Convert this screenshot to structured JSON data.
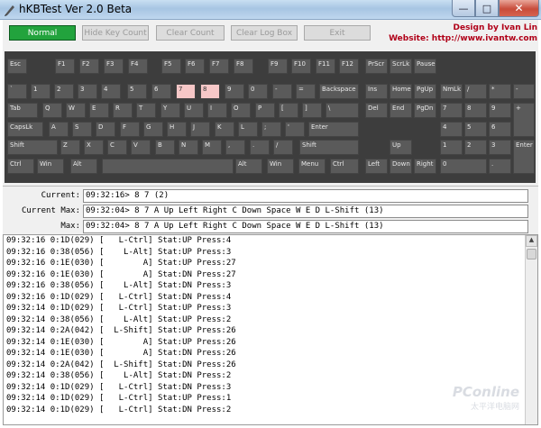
{
  "window": {
    "title": "hKBTest Ver 2.0 Beta",
    "min": "—",
    "max": "□",
    "close": "✕"
  },
  "toolbar": {
    "normal": "Normal",
    "hide_key_count": "Hide Key Count",
    "clear_count": "Clear Count",
    "clear_log_box": "Clear Log Box",
    "exit": "Exit"
  },
  "credits": {
    "line1": "Design by Ivan Lin",
    "line2": "Website: http://www.ivantw.com"
  },
  "keys": {
    "esc": "Esc",
    "f1": "F1",
    "f2": "F2",
    "f3": "F3",
    "f4": "F4",
    "f5": "F5",
    "f6": "F6",
    "f7": "F7",
    "f8": "F8",
    "f9": "F9",
    "f10": "F10",
    "f11": "F11",
    "f12": "F12",
    "prscr": "PrScr",
    "scrlk": "ScrLk",
    "pause": "Pause",
    "grave": "`",
    "k1": "1",
    "k2": "2",
    "k3": "3",
    "k4": "4",
    "k5": "5",
    "k6": "6",
    "k7": "7",
    "k8": "8",
    "k9": "9",
    "k0": "0",
    "minus": "-",
    "equal": "=",
    "backspace": "Backspace",
    "ins": "Ins",
    "home": "Home",
    "pgup": "PgUp",
    "numlk": "NmLk",
    "numslash": "/",
    "numstar": "*",
    "numminus": "-",
    "tab": "Tab",
    "q": "Q",
    "w": "W",
    "e": "E",
    "r": "R",
    "t": "T",
    "y": "Y",
    "u": "U",
    "i": "I",
    "o": "O",
    "p": "P",
    "lbracket": "[",
    "rbracket": "]",
    "backslash": "\\",
    "del": "Del",
    "end": "End",
    "pgdn": "PgDn",
    "n7": "7",
    "n8": "8",
    "n9": "9",
    "nplus": "+",
    "capslk": "CapsLk",
    "a": "A",
    "s": "S",
    "d": "D",
    "f": "F",
    "g": "G",
    "h": "H",
    "j": "J",
    "k": "K",
    "l": "L",
    "semicolon": ";",
    "quote": "'",
    "enter": "Enter",
    "n4": "4",
    "n5": "5",
    "n6": "6",
    "shift": "Shift",
    "z": "Z",
    "x": "X",
    "c": "C",
    "v": "V",
    "b": "B",
    "n": "N",
    "m": "M",
    "comma": ",",
    "period": ".",
    "slash": "/",
    "rshift": "Shift",
    "up": "Up",
    "n1": "1",
    "n2": "2",
    "n3": "3",
    "nenter": "Enter",
    "ctrl": "Ctrl",
    "win": "Win",
    "alt": "Alt",
    "space": "",
    "ralt": "Alt",
    "rwin": "Win",
    "menu": "Menu",
    "rctrl": "Ctrl",
    "left": "Left",
    "down": "Down",
    "right": "Right",
    "n0": "0",
    "ndot": "."
  },
  "pressed_keys": [
    "k7",
    "k8"
  ],
  "summary": {
    "current_label": "Current:",
    "current_value": "09:32:16> 8 7 (2)",
    "current_max_label": "Current Max:",
    "current_max_value": "09:32:04> 8 7 A Up Left Right C Down Space W E D L-Shift (13)",
    "max_label": "Max:",
    "max_value": "09:32:04> 8 7 A Up Left Right C Down Space W E D L-Shift (13)"
  },
  "log": [
    "09:32:16 0:1D(029) [   L-Ctrl] Stat:UP Press:4",
    "09:32:16 0:38(056) [    L-Alt] Stat:UP Press:3",
    "09:32:16 0:1E(030) [        A] Stat:UP Press:27",
    "09:32:16 0:1E(030) [        A] Stat:DN Press:27",
    "09:32:16 0:38(056) [    L-Alt] Stat:DN Press:3",
    "09:32:16 0:1D(029) [   L-Ctrl] Stat:DN Press:4",
    "09:32:14 0:1D(029) [   L-Ctrl] Stat:UP Press:3",
    "09:32:14 0:38(056) [    L-Alt] Stat:UP Press:2",
    "09:32:14 0:2A(042) [  L-Shift] Stat:UP Press:26",
    "09:32:14 0:1E(030) [        A] Stat:UP Press:26",
    "09:32:14 0:1E(030) [        A] Stat:DN Press:26",
    "09:32:14 0:2A(042) [  L-Shift] Stat:DN Press:26",
    "09:32:14 0:38(056) [    L-Alt] Stat:DN Press:2",
    "09:32:14 0:1D(029) [   L-Ctrl] Stat:DN Press:3",
    "09:32:14 0:1D(029) [   L-Ctrl] Stat:UP Press:1",
    "09:32:14 0:1D(029) [   L-Ctrl] Stat:DN Press:2"
  ],
  "watermark": {
    "main": "PConline",
    "sub": "太平洋电脑网"
  }
}
